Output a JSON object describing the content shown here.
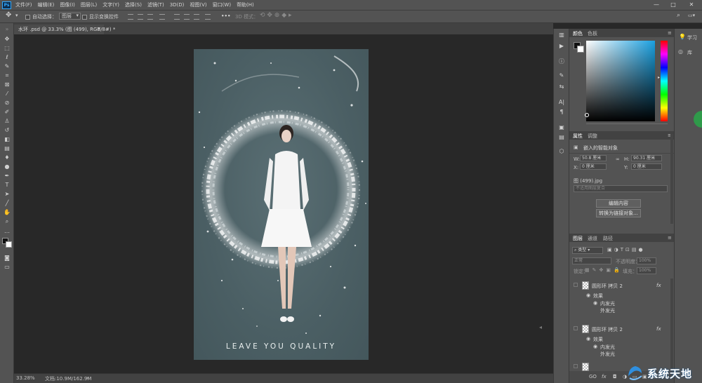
{
  "menu": {
    "logo": "Ps",
    "items": [
      "文件(F)",
      "编辑(E)",
      "图像(I)",
      "图层(L)",
      "文字(Y)",
      "选择(S)",
      "滤镜(T)",
      "3D(D)",
      "视图(V)",
      "窗口(W)",
      "帮助(H)"
    ],
    "window_controls": [
      "—",
      "□",
      "✕"
    ]
  },
  "options": {
    "auto_select_label": "自动选择：",
    "auto_select_value": "图层",
    "show_transform_label": "显示变换控件",
    "mode_3d_label": "3D 模式：",
    "more": "•••"
  },
  "document": {
    "tab_title": "水环 .psd @ 33.3% (图 (499), RGB/8#) *",
    "close": "×",
    "tagline": "LEAVE YOU QUALITY"
  },
  "status": {
    "zoom": "33.28%",
    "doc_info": "文档:10.9M/162.9M",
    "arrow": "›"
  },
  "color_panel": {
    "tabs": [
      "颜色",
      "色板"
    ],
    "foreground": "#111111",
    "background": "#ffffff"
  },
  "properties_panel": {
    "tabs": [
      "属性",
      "调整"
    ],
    "object_type": "嵌入的智能对象",
    "w_label": "W:",
    "w_value": "50.8",
    "h_label": "H:",
    "h_value": "90.31",
    "unit": "厘米",
    "x_label": "X:",
    "x_value": "0 厘米",
    "y_label": "Y:",
    "y_value": "0 厘米",
    "file_name": "图 (499).jpg",
    "comp_placeholder": "不适用图层复合",
    "edit_button": "编辑内容",
    "convert_button": "转换为链接对象..."
  },
  "layers_panel": {
    "tabs": [
      "图层",
      "通道",
      "路径"
    ],
    "filter_value": "类型",
    "blend_mode": "正常",
    "opacity_label": "不透明度：",
    "opacity_value": "100%",
    "lock_label": "锁定：",
    "fill_label": "填充：",
    "fill_value": "100%",
    "layers": [
      {
        "name": "圆形环 拷贝 2",
        "fx": "fx",
        "effects_label": "效果",
        "effect1": "内发光",
        "effect2": "外发光"
      },
      {
        "name": "圆形环 拷贝 2",
        "fx": "fx",
        "effects_label": "效果",
        "effect1": "内发光",
        "effect2": "外发光"
      }
    ],
    "bottom_icons": [
      "GO",
      "fx",
      "◘",
      "◑",
      "▭",
      "▣",
      "🗑"
    ]
  },
  "right_strip": {
    "learn_label": "学习",
    "library_label": "库"
  },
  "watermark": {
    "text": "系统天地"
  },
  "colors": {
    "chrome": "#535353",
    "workspace": "#282828",
    "document_bg": "#4b5f64",
    "accent": "#31a8ff"
  }
}
